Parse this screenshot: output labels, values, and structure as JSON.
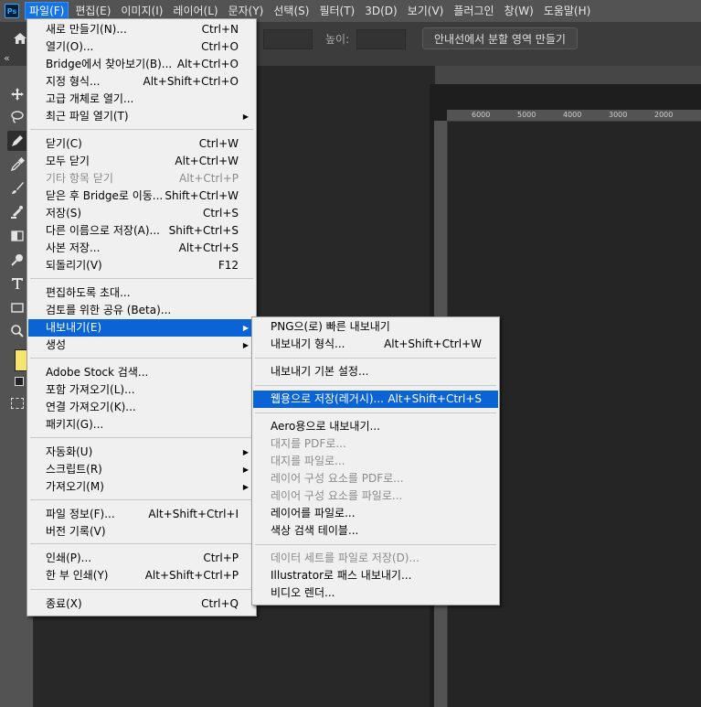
{
  "app": {
    "logo": "Ps"
  },
  "menubar": [
    "파일(F)",
    "편집(E)",
    "이미지(I)",
    "레이어(L)",
    "문자(Y)",
    "선택(S)",
    "필터(T)",
    "3D(D)",
    "보기(V)",
    "플러그인",
    "창(W)",
    "도움말(H)"
  ],
  "optionsbar": {
    "height_label": "높이:",
    "guides_button": "안내선에서 분할 영역 만들기"
  },
  "ruler": {
    "top_ticks": [
      "6000",
      "5000",
      "4000",
      "3000",
      "2000"
    ]
  },
  "file_menu": {
    "items": [
      {
        "label": "새로 만들기(N)...",
        "shortcut": "Ctrl+N"
      },
      {
        "label": "열기(O)...",
        "shortcut": "Ctrl+O"
      },
      {
        "label": "Bridge에서 찾아보기(B)...",
        "shortcut": "Alt+Ctrl+O"
      },
      {
        "label": "지정 형식...",
        "shortcut": "Alt+Shift+Ctrl+O"
      },
      {
        "label": "고급 개체로 열기...",
        "shortcut": ""
      },
      {
        "label": "최근 파일 열기(T)",
        "shortcut": "",
        "submenu": true
      },
      {
        "label": "닫기(C)",
        "shortcut": "Ctrl+W"
      },
      {
        "label": "모두 닫기",
        "shortcut": "Alt+Ctrl+W"
      },
      {
        "label": "기타 항목 닫기",
        "shortcut": "Alt+Ctrl+P",
        "disabled": true
      },
      {
        "label": "닫은 후 Bridge로 이동...",
        "shortcut": "Shift+Ctrl+W"
      },
      {
        "label": "저장(S)",
        "shortcut": "Ctrl+S"
      },
      {
        "label": "다른 이름으로 저장(A)...",
        "shortcut": "Shift+Ctrl+S"
      },
      {
        "label": "사본 저장...",
        "shortcut": "Alt+Ctrl+S"
      },
      {
        "label": "되돌리기(V)",
        "shortcut": "F12"
      },
      {
        "label": "편집하도록 초대...",
        "shortcut": ""
      },
      {
        "label": "검토를 위한 공유 (Beta)...",
        "shortcut": ""
      },
      {
        "label": "내보내기(E)",
        "shortcut": "",
        "submenu": true,
        "highlighted": true
      },
      {
        "label": "생성",
        "shortcut": "",
        "submenu": true
      },
      {
        "label": "Adobe Stock 검색...",
        "shortcut": ""
      },
      {
        "label": "포함 가져오기(L)...",
        "shortcut": ""
      },
      {
        "label": "연결 가져오기(K)...",
        "shortcut": ""
      },
      {
        "label": "패키지(G)...",
        "shortcut": ""
      },
      {
        "label": "자동화(U)",
        "shortcut": "",
        "submenu": true
      },
      {
        "label": "스크립트(R)",
        "shortcut": "",
        "submenu": true
      },
      {
        "label": "가져오기(M)",
        "shortcut": "",
        "submenu": true
      },
      {
        "label": "파일 정보(F)...",
        "shortcut": "Alt+Shift+Ctrl+I"
      },
      {
        "label": "버전 기록(V)",
        "shortcut": ""
      },
      {
        "label": "인쇄(P)...",
        "shortcut": "Ctrl+P"
      },
      {
        "label": "한 부 인쇄(Y)",
        "shortcut": "Alt+Shift+Ctrl+P"
      },
      {
        "label": "종료(X)",
        "shortcut": "Ctrl+Q"
      }
    ]
  },
  "export_submenu": {
    "items": [
      {
        "label": "PNG으(로) 빠른 내보내기",
        "shortcut": ""
      },
      {
        "label": "내보내기 형식...",
        "shortcut": "Alt+Shift+Ctrl+W"
      },
      {
        "label": "내보내기 기본 설정...",
        "shortcut": ""
      },
      {
        "label": "웹용으로 저장(레거시)...",
        "shortcut": "Alt+Shift+Ctrl+S",
        "highlighted": true
      },
      {
        "label": "Aero용으로 내보내기...",
        "shortcut": ""
      },
      {
        "label": "대지를 PDF로...",
        "shortcut": "",
        "disabled": true
      },
      {
        "label": "대지를 파일로...",
        "shortcut": "",
        "disabled": true
      },
      {
        "label": "레이어 구성 요소를 PDF로...",
        "shortcut": "",
        "disabled": true
      },
      {
        "label": "레이어 구성 요소를 파일로...",
        "shortcut": "",
        "disabled": true
      },
      {
        "label": "레이어를 파일로...",
        "shortcut": ""
      },
      {
        "label": "색상 검색 테이블...",
        "shortcut": ""
      },
      {
        "label": "데이터 세트를 파일로 저장(D)...",
        "shortcut": "",
        "disabled": true
      },
      {
        "label": "Illustrator로 패스 내보내기...",
        "shortcut": ""
      },
      {
        "label": "비디오 렌더...",
        "shortcut": ""
      }
    ]
  },
  "colors": {
    "accent": "#0a64d6",
    "foreground_swatch": "#f5e56b"
  },
  "toolbar_icons": [
    "move-icon",
    "lasso-icon",
    "pen-icon",
    "eyedropper-icon",
    "brush-icon",
    "clone-stamp-icon",
    "gradient-icon",
    "zoom-search-icon",
    "type-icon",
    "rectangle-icon",
    "zoom-icon"
  ]
}
